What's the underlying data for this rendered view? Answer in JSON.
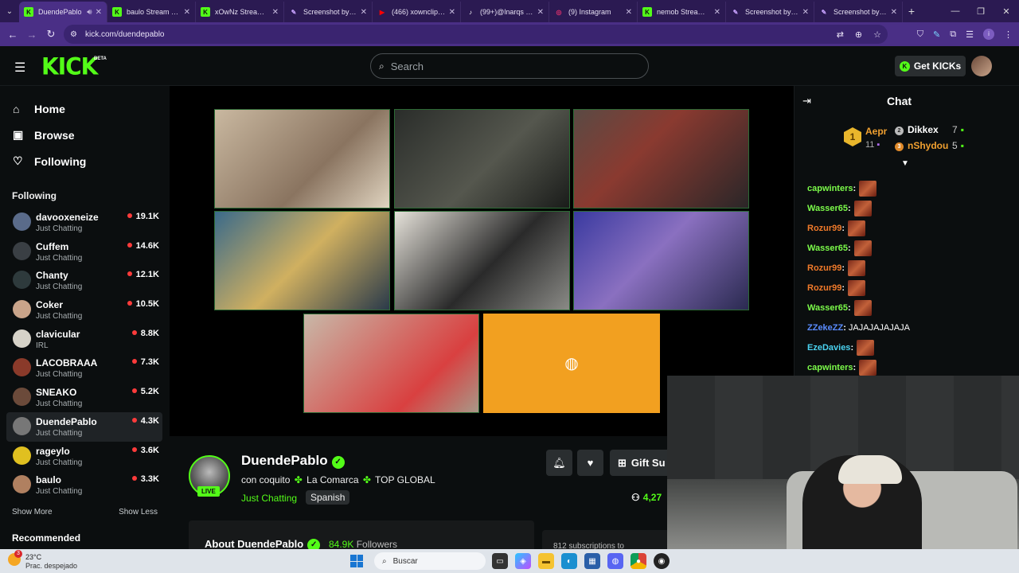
{
  "browser": {
    "tabs": [
      {
        "title": "DuendePablo",
        "icon": "kick-icon",
        "color": "#53fc18",
        "active": true
      },
      {
        "title": "baulo Stream - W",
        "icon": "kick-icon",
        "color": "#53fc18"
      },
      {
        "title": "xOwNz Stream - W",
        "icon": "kick-icon",
        "color": "#53fc18"
      },
      {
        "title": "Screenshot by Lig",
        "icon": "feather-icon",
        "color": "#c8a2ff"
      },
      {
        "title": "(466) xownclips -",
        "icon": "youtube-icon",
        "color": "#ff0000"
      },
      {
        "title": "(99+)@lnarqs y u",
        "icon": "tiktok-icon",
        "color": "#ffffff"
      },
      {
        "title": "(9) Instagram",
        "icon": "instagram-icon",
        "color": "#e1306c"
      },
      {
        "title": "nemob Stream - W",
        "icon": "kick-icon",
        "color": "#53fc18"
      },
      {
        "title": "Screenshot by Lig",
        "icon": "feather-icon",
        "color": "#c8a2ff"
      },
      {
        "title": "Screenshot by Lig",
        "icon": "feather-icon",
        "color": "#c8a2ff"
      }
    ],
    "url": "kick.com/duendepablo"
  },
  "kick": {
    "logo": "KICK",
    "beta": "BETA",
    "search_placeholder": "Search",
    "get_kicks": "Get KICKs",
    "accent": "#53fc18"
  },
  "sidebar": {
    "nav": [
      {
        "label": "Home",
        "icon": "home-icon"
      },
      {
        "label": "Browse",
        "icon": "browse-icon"
      },
      {
        "label": "Following",
        "icon": "heart-icon"
      }
    ],
    "following_title": "Following",
    "channels": [
      {
        "name": "davooxeneize",
        "category": "Just Chatting",
        "viewers": "19.1K",
        "color": "#5a6b8a"
      },
      {
        "name": "Cuffem",
        "category": "Just Chatting",
        "viewers": "14.6K",
        "color": "#3a3f44"
      },
      {
        "name": "Chanty",
        "category": "Just Chatting",
        "viewers": "12.1K",
        "color": "#2e3a3c"
      },
      {
        "name": "Coker",
        "category": "Just Chatting",
        "viewers": "10.5K",
        "color": "#c9a48a"
      },
      {
        "name": "clavicular",
        "category": "IRL",
        "viewers": "8.8K",
        "color": "#d6d2c8"
      },
      {
        "name": "LACOBRAAA",
        "category": "Just Chatting",
        "viewers": "7.3K",
        "color": "#8a3a2a"
      },
      {
        "name": "SNEAKO",
        "category": "Just Chatting",
        "viewers": "5.2K",
        "color": "#6b4a3a"
      },
      {
        "name": "DuendePablo",
        "category": "Just Chatting",
        "viewers": "4.3K",
        "color": "#777777",
        "selected": true
      },
      {
        "name": "rageylo",
        "category": "Just Chatting",
        "viewers": "3.6K",
        "color": "#e0c020"
      },
      {
        "name": "baulo",
        "category": "Just Chatting",
        "viewers": "3.3K",
        "color": "#b08060"
      }
    ],
    "show_more": "Show More",
    "show_less": "Show Less",
    "recommended": "Recommended"
  },
  "player": {
    "cams": [
      {
        "bg": "linear-gradient(135deg,#c9b8a0,#8a7460 60%,#e0d4c0)"
      },
      {
        "bg": "linear-gradient(135deg,#2a2d2a,#55574e 55%,#1a1c1a)"
      },
      {
        "bg": "linear-gradient(135deg,#5a4a44,#8a3a30 40%,#2a2628)"
      },
      {
        "bg": "linear-gradient(135deg,#3a6a8a,#d0b060 50%,#2a3a4a)"
      },
      {
        "bg": "linear-gradient(135deg,#e6e2da,#2a2a2a 55%,#8a8a86)"
      },
      {
        "bg": "linear-gradient(135deg,#3a3aa0,#8a70c0 45%,#2a2a50)"
      },
      {
        "bg": "linear-gradient(135deg,#c8b8a8,#d94040 70%,#a89888)"
      }
    ],
    "discord_color": "#f2a020"
  },
  "channel": {
    "name": "DuendePablo",
    "live_label": "LIVE",
    "title_parts": [
      "con coquito",
      "La Comarca",
      "TOP GLOBAL"
    ],
    "category": "Just Chatting",
    "language": "Spanish",
    "gift_label": "Gift Su",
    "viewers": "4,27",
    "about_title": "About DuendePablo",
    "followers_count": "84.9K",
    "followers_label": "Followers",
    "subs_label": "812 subscriptions to"
  },
  "chat": {
    "title": "Chat",
    "leaderboard": {
      "first": {
        "name": "Aepr",
        "count": "11",
        "rank": "1"
      },
      "second": {
        "name": "Dikkex",
        "count": "7",
        "rank": "2"
      },
      "third": {
        "name": "nShydou",
        "count": "5",
        "rank": "3"
      }
    },
    "messages": [
      {
        "user": "capwinters",
        "color": "#7cfc4a",
        "text": "",
        "emote": true
      },
      {
        "user": "Wasser65",
        "color": "#7cfc4a",
        "text": "",
        "emote": true
      },
      {
        "user": "Rozur99",
        "color": "#f07a2a",
        "text": "",
        "emote": true
      },
      {
        "user": "Wasser65",
        "color": "#7cfc4a",
        "text": "",
        "emote": true
      },
      {
        "user": "Rozur99",
        "color": "#f07a2a",
        "text": "",
        "emote": true
      },
      {
        "user": "Rozur99",
        "color": "#f07a2a",
        "text": "",
        "emote": true
      },
      {
        "user": "Wasser65",
        "color": "#7cfc4a",
        "text": "",
        "emote": true
      },
      {
        "user": "ZZekeZZ",
        "color": "#5a8cff",
        "text": "JAJAJAJAJAJA",
        "emote": false
      },
      {
        "user": "EzeDavies",
        "color": "#4ad2f0",
        "text": "",
        "emote": true
      },
      {
        "user": "capwinters",
        "color": "#7cfc4a",
        "text": "",
        "emote": true
      }
    ]
  },
  "taskbar": {
    "temp": "23°C",
    "weather": "Prac. despejado",
    "notif": "3",
    "search": "Buscar"
  }
}
